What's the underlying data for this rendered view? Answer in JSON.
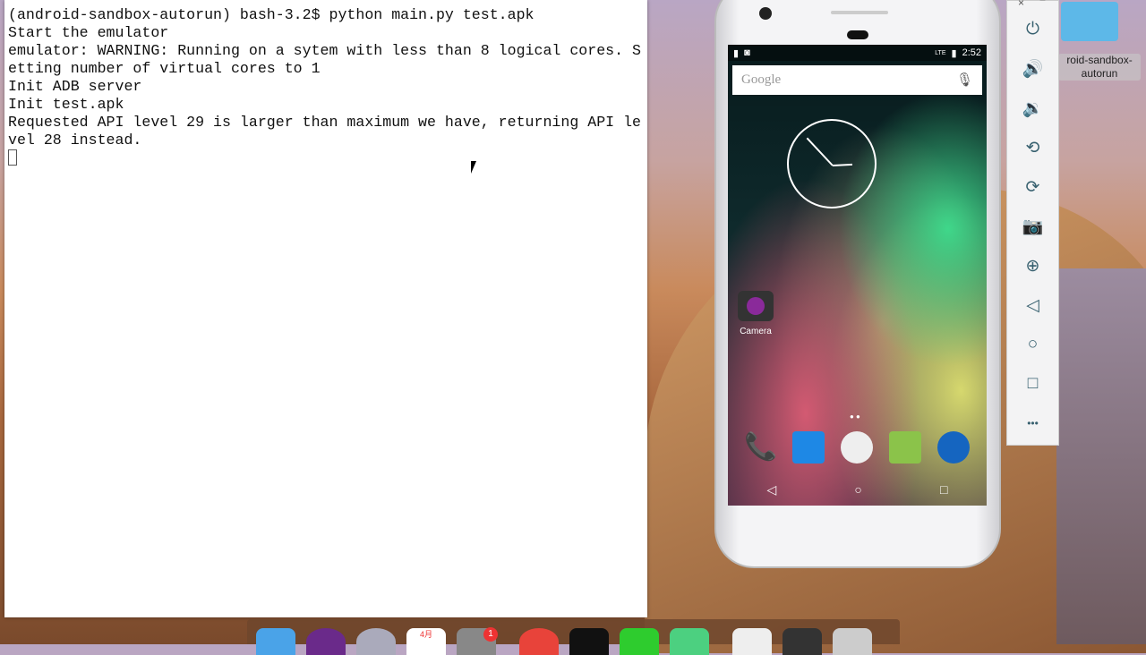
{
  "terminal": {
    "lines": [
      "(android-sandbox-autorun) bash-3.2$ python main.py test.apk",
      "Start the emulator",
      "emulator: WARNING: Running on a sytem with less than 8 logical cores. S",
      "etting number of virtual cores to 1",
      "Init ADB server",
      "Init test.apk",
      "Requested API level 29 is larger than maximum we have, returning API le",
      "vel 28 instead."
    ]
  },
  "phone": {
    "status_time": "2:52",
    "network": "LTE",
    "search_placeholder": "Google",
    "camera_label": "Camera",
    "nav": {
      "back": "◁",
      "home": "○",
      "recents": "□"
    }
  },
  "toolbar": {
    "close": "×",
    "minimize": "−",
    "items": [
      {
        "icon": "power-icon",
        "glyph": "⏻"
      },
      {
        "icon": "volume-up-icon",
        "glyph": "🔊"
      },
      {
        "icon": "volume-down-icon",
        "glyph": "🔉"
      },
      {
        "icon": "rotate-left-icon",
        "glyph": "⟲"
      },
      {
        "icon": "rotate-right-icon",
        "glyph": "⟳"
      },
      {
        "icon": "screenshot-icon",
        "glyph": "📷"
      },
      {
        "icon": "zoom-icon",
        "glyph": "⊕"
      },
      {
        "icon": "back-icon",
        "glyph": "◁"
      },
      {
        "icon": "home-icon",
        "glyph": "○"
      },
      {
        "icon": "overview-icon",
        "glyph": "□"
      },
      {
        "icon": "more-icon",
        "glyph": "•••"
      }
    ]
  },
  "desktop": {
    "folder_label": "roid-sandbox-autorun"
  },
  "dock": {
    "badge": "1",
    "calendar_month": "4月"
  }
}
